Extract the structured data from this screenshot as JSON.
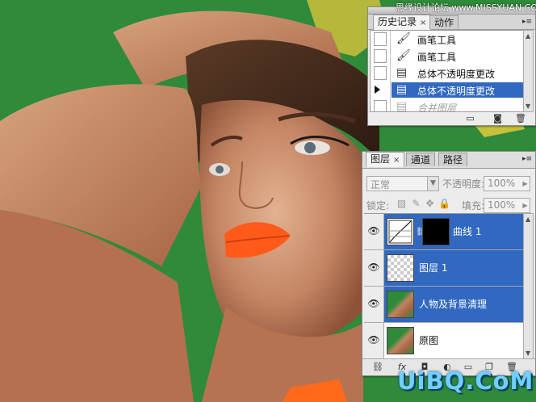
{
  "watermarks": {
    "top": "思缘设计论坛 www.MISSYUAN.COM",
    "bottom": "UiBQ.CoM"
  },
  "history_panel": {
    "tabs": [
      {
        "label": "历史记录",
        "close": "×",
        "active": true
      },
      {
        "label": "动作",
        "active": false
      }
    ],
    "steps": [
      {
        "label": "画笔工具",
        "icon": "brush-icon",
        "state": "normal"
      },
      {
        "label": "画笔工具",
        "icon": "brush-icon",
        "state": "normal"
      },
      {
        "label": "总体不透明度更改",
        "icon": "history-state-icon",
        "state": "normal"
      },
      {
        "label": "总体不透明度更改",
        "icon": "history-state-icon",
        "state": "selected"
      },
      {
        "label": "合并图层",
        "icon": "history-state-icon",
        "state": "greyed"
      }
    ],
    "footer_icons": [
      "new-document-from-state-icon",
      "snapshot-icon",
      "trash-icon"
    ]
  },
  "layers_panel": {
    "tabs": [
      {
        "label": "图层",
        "close": "×",
        "active": true
      },
      {
        "label": "通道",
        "active": false
      },
      {
        "label": "路径",
        "active": false
      }
    ],
    "blend_mode": "正常",
    "opacity_label": "不透明度:",
    "opacity_value": "100%",
    "lock_label": "锁定:",
    "fill_label": "填充:",
    "fill_value": "100%",
    "layers": [
      {
        "name": "曲线 1",
        "selected": true,
        "type": "adjustment"
      },
      {
        "name": "图层 1",
        "selected": true,
        "type": "transparent"
      },
      {
        "name": "人物及背景清理",
        "selected": true,
        "type": "photo"
      },
      {
        "name": "原图",
        "selected": false,
        "type": "photo"
      }
    ],
    "footer_icons": [
      "link-icon",
      "fx-icon",
      "mask-icon",
      "adjustment-icon",
      "folder-icon",
      "new-layer-icon",
      "trash-icon"
    ]
  },
  "colors": {
    "background_green": "#2f8a3a",
    "selection_blue": "#3168c0",
    "lips_orange": "#ff5a1a"
  }
}
